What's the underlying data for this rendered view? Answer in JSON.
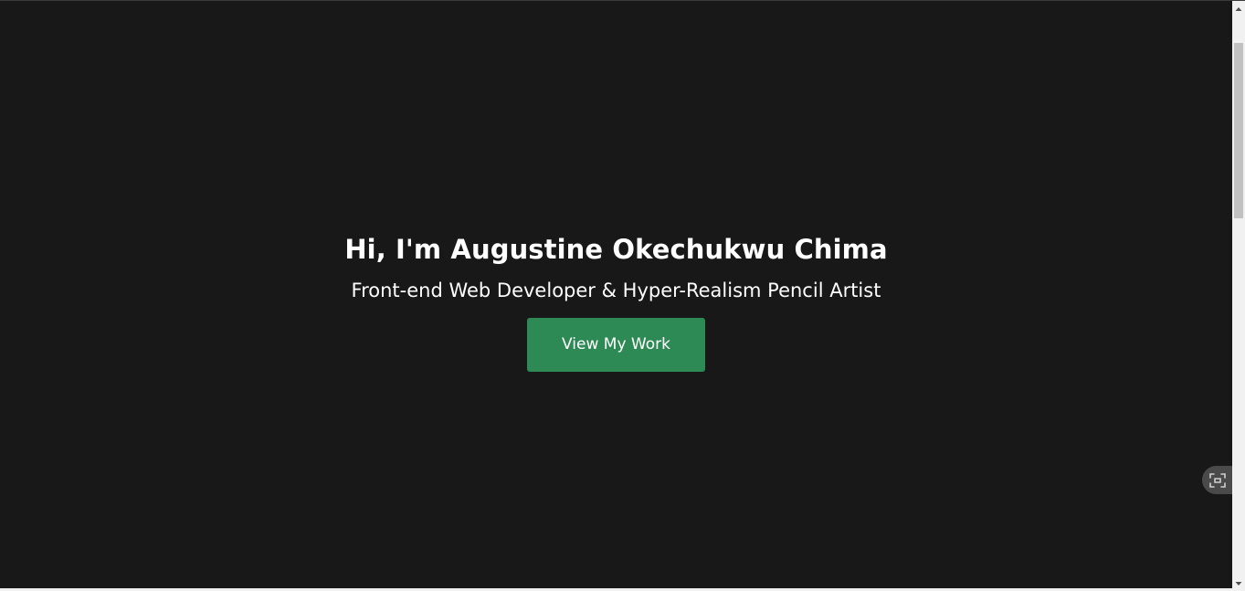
{
  "hero": {
    "title": "Hi, I'm Augustine Okechukwu Chima",
    "subtitle": "Front-end Web Developer & Hyper-Realism Pencil Artist",
    "cta_label": "View My Work"
  },
  "icons": {
    "floating_widget": "screen-capture-icon",
    "scroll_up": "chevron-up-icon",
    "scroll_down": "chevron-down-icon"
  },
  "colors": {
    "background": "#181818",
    "text": "#ffffff",
    "accent": "#2e8a55"
  }
}
